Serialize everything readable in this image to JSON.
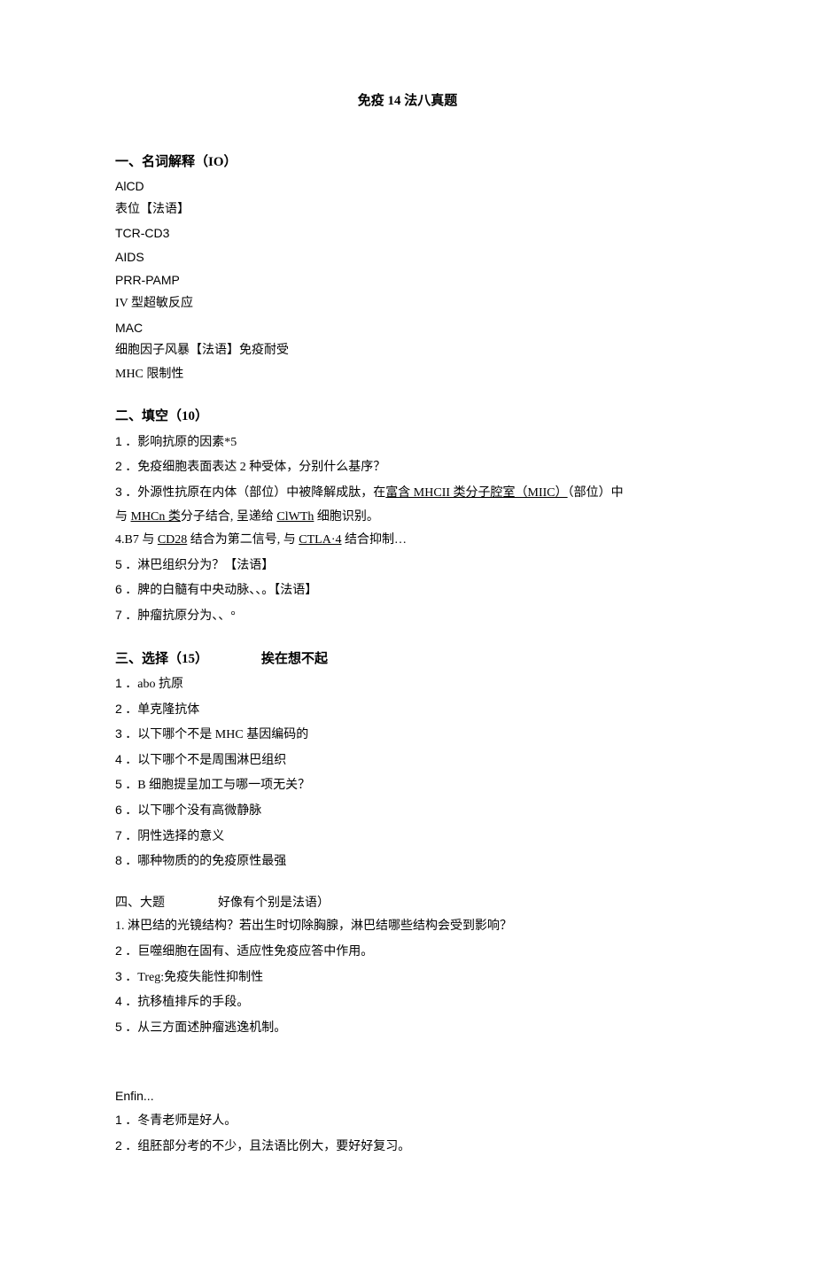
{
  "title": "免疫 14 法八真题",
  "s1": {
    "heading": "一、名词解释（IO）",
    "items": [
      "AlCD",
      "表位【法语】",
      "TCR-CD3",
      "AIDS",
      "PRR-PAMP",
      "IV 型超敏反应",
      "MAC",
      "细胞因子风暴【法语】免疫耐受",
      "MHC 限制性"
    ]
  },
  "s2": {
    "heading": "二、填空（10）",
    "i1": {
      "n": "1",
      "t": " ．影响抗原的因素*5"
    },
    "i2": {
      "n": "2",
      "t": " ．免疫细胞表面表达 2 种受体，分别什么基序？"
    },
    "i3": {
      "n": "3",
      "a": " ．外源性抗原在内体（部位）中被降解成肽，在",
      "u1": "富含 MHCII 类分子腔室（MIIC）",
      "b": "（部位）中",
      "c": "与 ",
      "u2": "MHCn 类",
      "d": "分子结合, 呈递给 ",
      "u3": "ClWTh",
      "e": " 细胞识别。"
    },
    "i4": {
      "a": "4.B7 与 ",
      "u1": "CD28",
      "b": " 结合为第二信号, 与 ",
      "u2": "CTLA·4",
      "c": " 结合抑制…"
    },
    "i5": {
      "n": "5",
      "t": " ．淋巴组织分为？【法语】"
    },
    "i6": {
      "n": "6",
      "t": " ．脾的白髓有中央动脉、、。【法语】"
    },
    "i7": {
      "n": "7",
      "t": " ．肿瘤抗原分为、、°"
    }
  },
  "s3": {
    "heading_a": "三、选择（15）",
    "heading_b": "挨在想不起",
    "i1": {
      "n": "1",
      "t": " ．abo 抗原"
    },
    "i2": {
      "n": "2",
      "t": " ．单克隆抗体"
    },
    "i3": {
      "n": "3",
      "t": " ．以下哪个不是 MHC 基因编码的"
    },
    "i4": {
      "n": "4",
      "t": " ．以下哪个不是周围淋巴组织"
    },
    "i5": {
      "n": "5",
      "t": " ．B 细胞提呈加工与哪一项无关？"
    },
    "i6": {
      "n": "6",
      "t": " ．以下哪个没有高微静脉"
    },
    "i7": {
      "n": "7",
      "t": " ．阴性选择的意义"
    },
    "i8": {
      "n": "8",
      "t": " ．哪种物质的的免疫原性最强"
    }
  },
  "s4": {
    "heading_a": "四、大题",
    "heading_b": "好像有个别是法语）",
    "i1": {
      "t": "1. 淋巴结的光镜结构？若出生时切除胸腺，淋巴结哪些结构会受到影响？"
    },
    "i2": {
      "n": "2",
      "t": " ．巨噬细胞在固有、适应性免疫应答中作用。"
    },
    "i3": {
      "n": "3",
      "t": " ．Treg:免疫失能性抑制性"
    },
    "i4": {
      "n": "4",
      "t": " ．抗移植排斥的手段。"
    },
    "i5": {
      "n": "5",
      "t": " ．从三方面述肿瘤逃逸机制。"
    }
  },
  "s5": {
    "heading": "Enfin...",
    "i1": {
      "n": "1",
      "t": " ．冬青老师是好人。"
    },
    "i2": {
      "n": "2",
      "t": " ．组胚部分考的不少，且法语比例大，要好好复习。"
    }
  }
}
